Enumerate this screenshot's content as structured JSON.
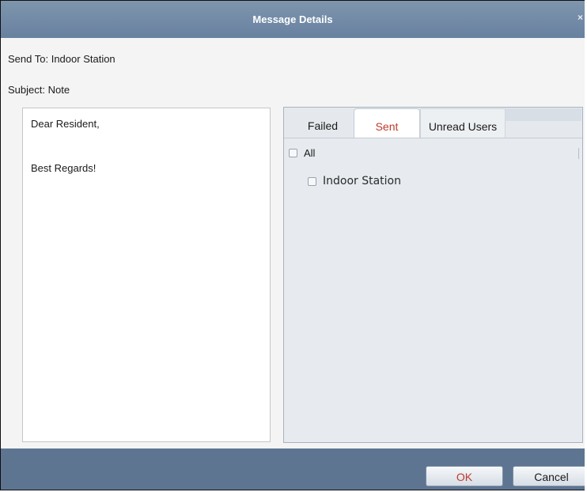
{
  "window": {
    "title": "Message Details",
    "close_glyph": "×"
  },
  "send_to": {
    "label": "Send To:",
    "value": "Indoor Station"
  },
  "subject": {
    "label": "Subject:",
    "value": "Note"
  },
  "message": {
    "lines": [
      "Dear Resident,",
      "Best Regards!"
    ]
  },
  "tabs": [
    {
      "label": "Failed",
      "active": false
    },
    {
      "label": "Sent",
      "active": true
    },
    {
      "label": "Unread Users",
      "active": false
    }
  ],
  "recipients": {
    "all_label": "All",
    "all_checked": false,
    "items": [
      {
        "label": "Indoor Station",
        "checked": false
      }
    ]
  },
  "buttons": {
    "ok": "OK",
    "cancel": "Cancel"
  },
  "colors": {
    "titlebar": "#7088a4",
    "footer": "#5e7592",
    "accent_red": "#c0392b"
  }
}
